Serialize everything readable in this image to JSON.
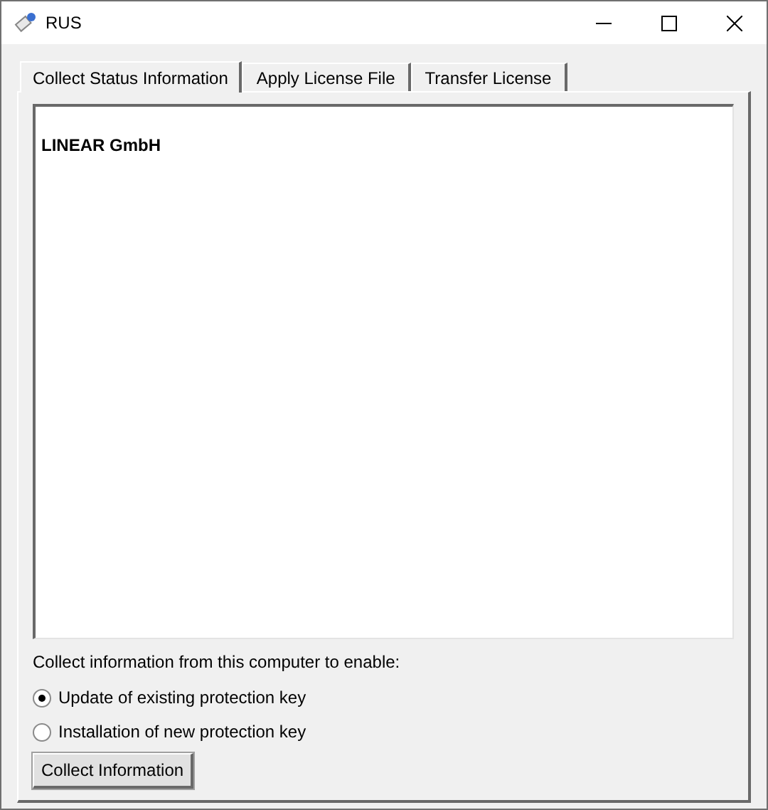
{
  "window": {
    "title": "RUS"
  },
  "tabs": [
    {
      "label": "Collect Status Information",
      "selected": true
    },
    {
      "label": "Apply License File",
      "selected": false
    },
    {
      "label": "Transfer License",
      "selected": false
    }
  ],
  "info_box": {
    "text": "LINEAR GmbH"
  },
  "prompt": "Collect information from this computer to enable:",
  "options": [
    {
      "label": "Update of existing protection key",
      "selected": true
    },
    {
      "label": "Installation of new protection key",
      "selected": false
    }
  ],
  "button": "Collect Information"
}
